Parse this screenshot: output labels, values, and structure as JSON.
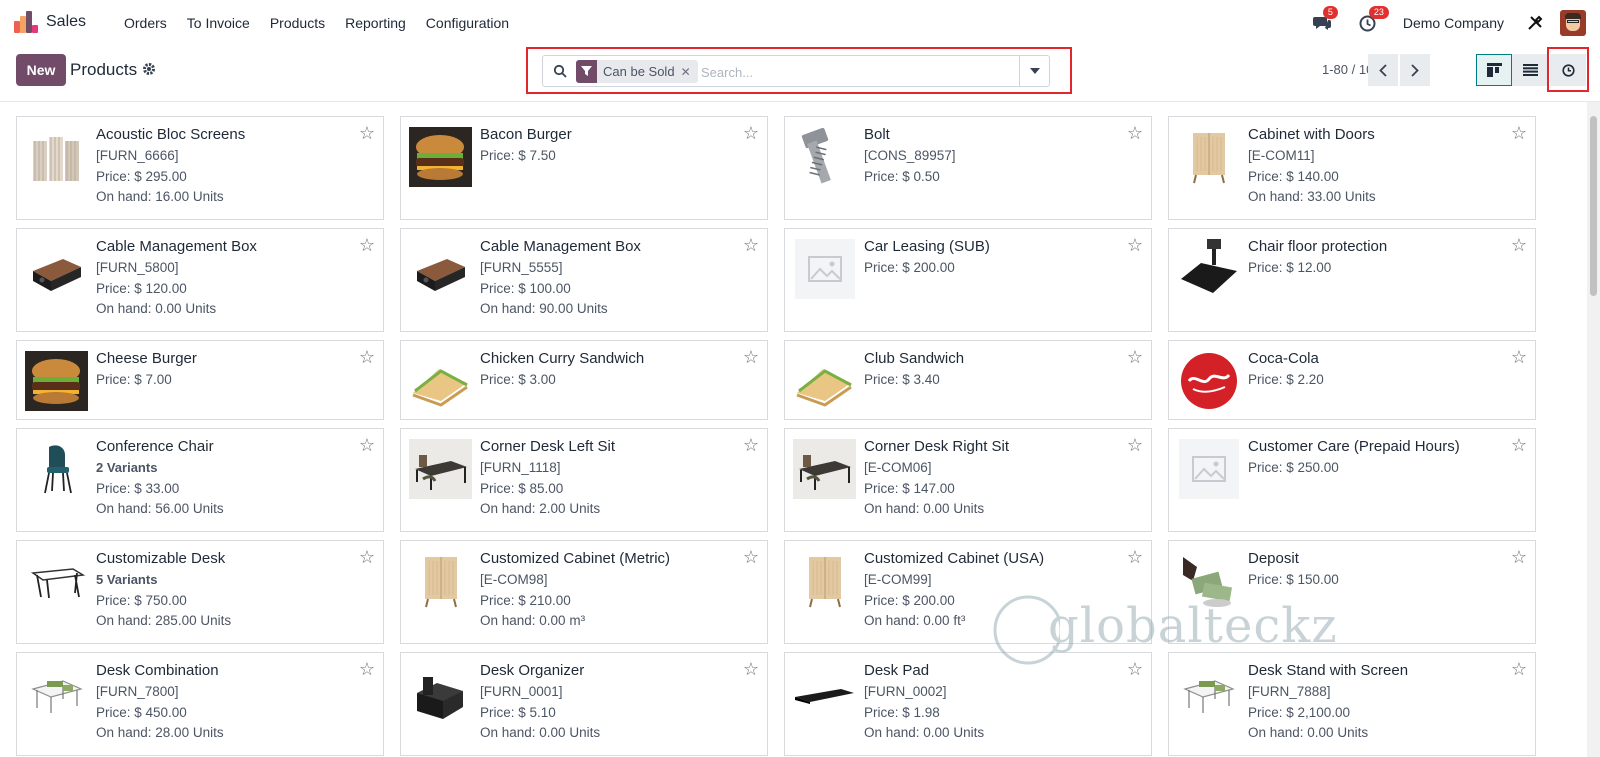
{
  "app": {
    "name": "Sales"
  },
  "menu": [
    "Orders",
    "To Invoice",
    "Products",
    "Reporting",
    "Configuration"
  ],
  "systray": {
    "messages_count": "5",
    "activities_count": "23",
    "company": "Demo Company"
  },
  "control": {
    "new_label": "New",
    "title": "Products",
    "search": {
      "facet": "Can be Sold",
      "placeholder": "Search..."
    },
    "pager": "1-80 / 100"
  },
  "products": [
    {
      "name": "Acoustic Bloc Screens",
      "ref": "[FURN_6666]",
      "price": "Price: $ 295.00",
      "onhand": "On hand: 16.00 Units",
      "img": "screen"
    },
    {
      "name": "Bacon Burger",
      "price": "Price: $ 7.50",
      "img": "burger"
    },
    {
      "name": "Bolt",
      "ref": "[CONS_89957]",
      "price": "Price: $ 0.50",
      "img": "bolt"
    },
    {
      "name": "Cabinet with Doors",
      "ref": "[E-COM11]",
      "price": "Price: $ 140.00",
      "onhand": "On hand: 33.00 Units",
      "img": "cabinet"
    },
    {
      "name": "Cable Management Box",
      "ref": "[FURN_5800]",
      "price": "Price: $ 120.00",
      "onhand": "On hand: 0.00 Units",
      "img": "cablebox"
    },
    {
      "name": "Cable Management Box",
      "ref": "[FURN_5555]",
      "price": "Price: $ 100.00",
      "onhand": "On hand: 90.00 Units",
      "img": "cablebox"
    },
    {
      "name": "Car Leasing (SUB)",
      "price": "Price: $ 200.00",
      "img": "placeholder"
    },
    {
      "name": "Chair floor protection",
      "price": "Price: $ 12.00",
      "img": "floormat"
    },
    {
      "name": "Cheese Burger",
      "price": "Price: $ 7.00",
      "img": "burger"
    },
    {
      "name": "Chicken Curry Sandwich",
      "price": "Price: $ 3.00",
      "img": "sandwich"
    },
    {
      "name": "Club Sandwich",
      "price": "Price: $ 3.40",
      "img": "sandwich"
    },
    {
      "name": "Coca-Cola",
      "price": "Price: $ 2.20",
      "img": "coke"
    },
    {
      "name": "Conference Chair",
      "variants": "2 Variants",
      "price": "Price: $ 33.00",
      "onhand": "On hand: 56.00 Units",
      "img": "chair"
    },
    {
      "name": "Corner Desk Left Sit",
      "ref": "[FURN_1118]",
      "price": "Price: $ 85.00",
      "onhand": "On hand: 2.00 Units",
      "img": "desk"
    },
    {
      "name": "Corner Desk Right Sit",
      "ref": "[E-COM06]",
      "price": "Price: $ 147.00",
      "onhand": "On hand: 0.00 Units",
      "img": "desk"
    },
    {
      "name": "Customer Care (Prepaid Hours)",
      "price": "Price: $ 250.00",
      "img": "placeholder"
    },
    {
      "name": "Customizable Desk",
      "variants": "5 Variants",
      "price": "Price: $ 750.00",
      "onhand": "On hand: 285.00 Units",
      "img": "table"
    },
    {
      "name": "Customized Cabinet (Metric)",
      "ref": "[E-COM98]",
      "price": "Price: $ 210.00",
      "onhand": "On hand: 0.00 m³",
      "img": "cabinet"
    },
    {
      "name": "Customized Cabinet (USA)",
      "ref": "[E-COM99]",
      "price": "Price: $ 200.00",
      "onhand": "On hand: 0.00 ft³",
      "img": "cabinet"
    },
    {
      "name": "Deposit",
      "price": "Price: $ 150.00",
      "img": "money"
    },
    {
      "name": "Desk Combination",
      "ref": "[FURN_7800]",
      "price": "Price: $ 450.00",
      "onhand": "On hand: 28.00 Units",
      "img": "combo"
    },
    {
      "name": "Desk Organizer",
      "ref": "[FURN_0001]",
      "price": "Price: $ 5.10",
      "onhand": "On hand: 0.00 Units",
      "img": "organizer"
    },
    {
      "name": "Desk Pad",
      "ref": "[FURN_0002]",
      "price": "Price: $ 1.98",
      "onhand": "On hand: 0.00 Units",
      "img": "pad"
    },
    {
      "name": "Desk Stand with Screen",
      "ref": "[FURN_7888]",
      "price": "Price: $ 2,100.00",
      "onhand": "On hand: 0.00 Units",
      "img": "combo"
    }
  ],
  "watermark": "globalteckz"
}
